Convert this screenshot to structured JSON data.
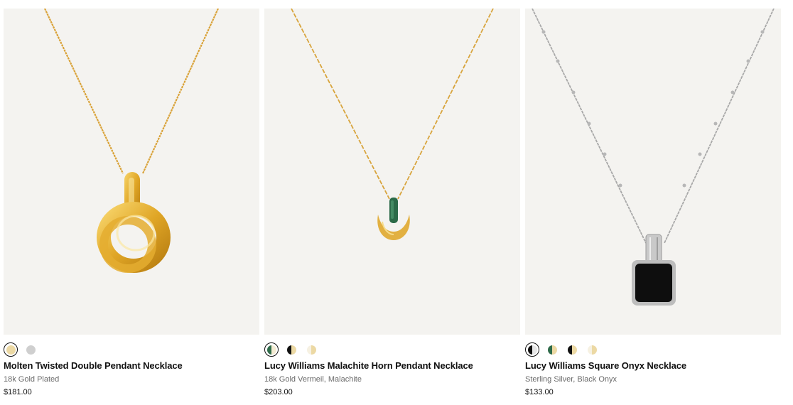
{
  "products": [
    {
      "name": "Molten Twisted Double Pendant Necklace",
      "material": "18k Gold Plated",
      "price": "$181.00",
      "image_alt": "gold twisted double pendant necklace",
      "swatches": [
        {
          "name": "gold",
          "colors": [
            "#ecd9a4",
            "#ecd9a4"
          ],
          "selected": true
        },
        {
          "name": "silver",
          "colors": [
            "#cfcfcf",
            "#cfcfcf"
          ],
          "selected": false
        }
      ]
    },
    {
      "name": "Lucy Williams Malachite Horn Pendant Necklace",
      "material": "18k Gold Vermeil, Malachite",
      "price": "$203.00",
      "image_alt": "gold horn pendant necklace with malachite",
      "swatches": [
        {
          "name": "malachite",
          "colors": [
            "#2f6b4a",
            "#f3ebd2"
          ],
          "selected": true
        },
        {
          "name": "onyx-gold",
          "colors": [
            "#111111",
            "#ecd9a4"
          ],
          "selected": false
        },
        {
          "name": "pearl-gold",
          "colors": [
            "#f6f1e2",
            "#ecd9a4"
          ],
          "selected": false
        }
      ]
    },
    {
      "name": "Lucy Williams Square Onyx Necklace",
      "material": "Sterling Silver, Black Onyx",
      "price": "$133.00",
      "image_alt": "silver necklace with square black onyx pendant",
      "swatches": [
        {
          "name": "onyx-silver",
          "colors": [
            "#111111",
            "#e6e6e6"
          ],
          "selected": true
        },
        {
          "name": "malachite-gold",
          "colors": [
            "#2f6b4a",
            "#ecd9a4"
          ],
          "selected": false
        },
        {
          "name": "onyx-gold",
          "colors": [
            "#111111",
            "#ecd9a4"
          ],
          "selected": false
        },
        {
          "name": "pearl-gold",
          "colors": [
            "#f6f1e2",
            "#ecd9a4"
          ],
          "selected": false
        }
      ]
    }
  ],
  "colors": {
    "image_background": "#f4f3f0",
    "gold": "#e0aa2a",
    "silver": "#c9c9c9",
    "text": "#111111",
    "muted_text": "#6a6a6a"
  }
}
